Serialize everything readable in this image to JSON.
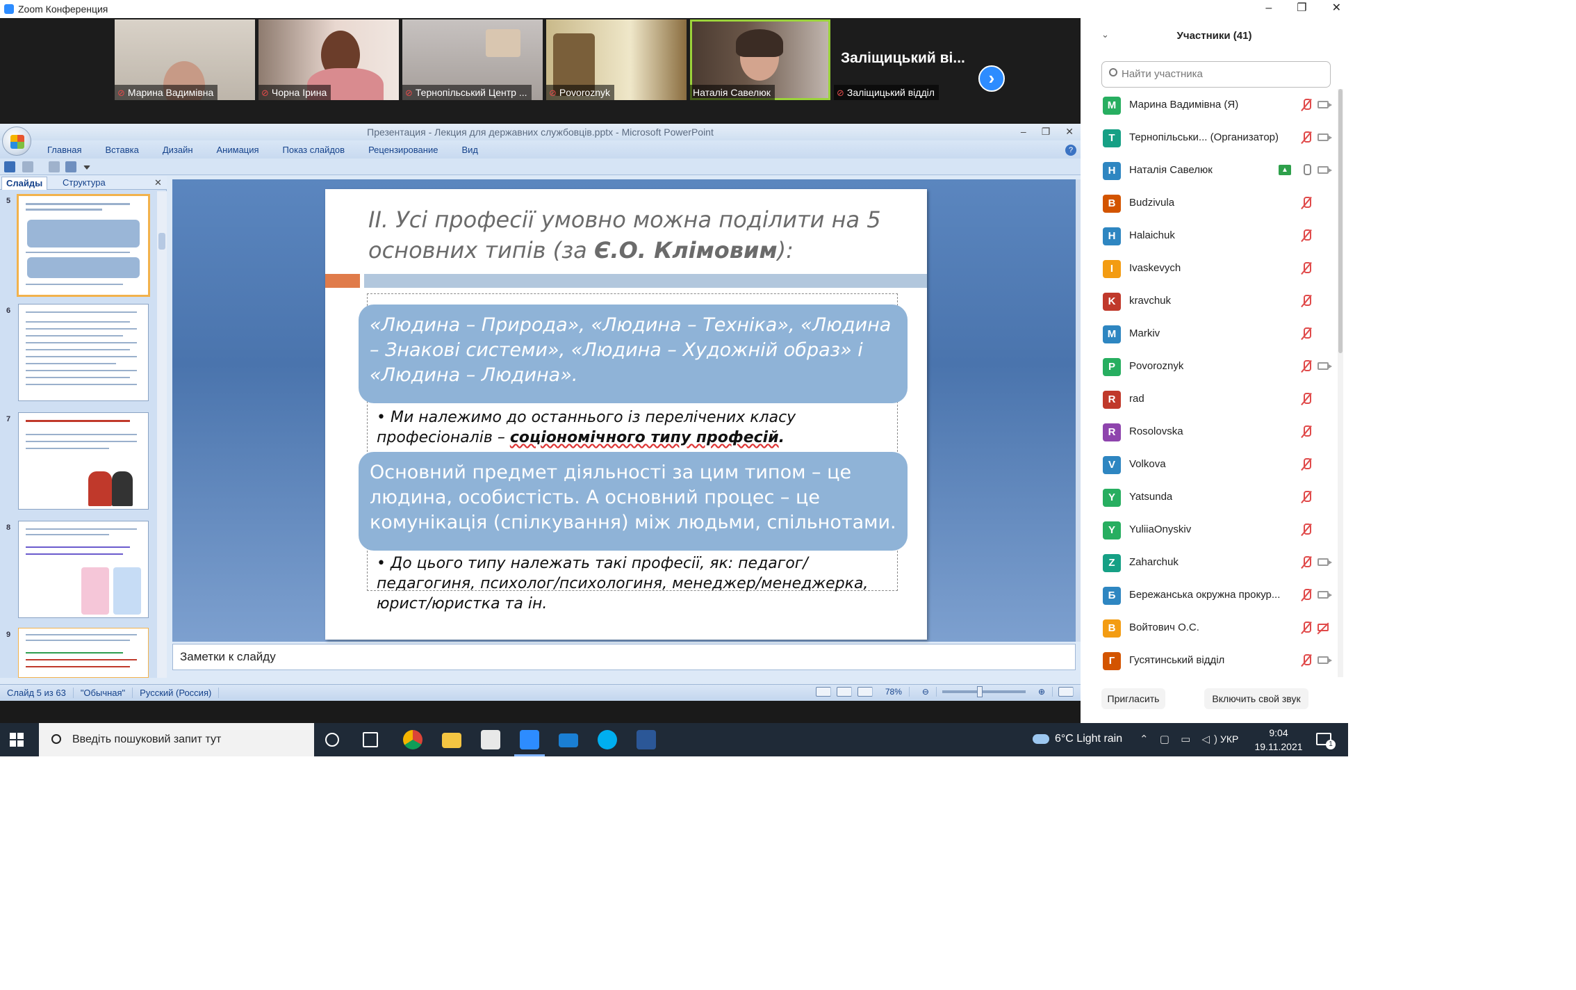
{
  "zoom": {
    "window_title": "Zoom Конференция",
    "tiles": [
      {
        "name": "Марина Вадимівна"
      },
      {
        "name": "Чорна Ірина"
      },
      {
        "name": "Тернопільський Центр ..."
      },
      {
        "name": "Povoroznyk"
      },
      {
        "name": "Наталія Савелюк"
      },
      {
        "name": "Заліщицький відділ",
        "big_label": "Заліщицький ві..."
      }
    ]
  },
  "ppt": {
    "title": "Презентация - Лекция для державних службовців.pptx - Microsoft PowerPoint",
    "ribbon": [
      "Главная",
      "Вставка",
      "Дизайн",
      "Анимация",
      "Показ слайдов",
      "Рецензирование",
      "Вид"
    ],
    "pane_tabs": {
      "slides": "Слайды",
      "outline": "Структура"
    },
    "thumb_numbers": [
      "5",
      "6",
      "7",
      "8",
      "9"
    ],
    "slide": {
      "title_part1": "ІІ. Усі професії умовно можна поділити на 5 основних типів (за ",
      "title_bold": "Є.О. Клімовим",
      "title_part2": "):",
      "bubble1": "«Людина – Природа», «Людина – Техніка», «Людина – Знакові системи», «Людина – Художній образ» і «Людина – Людина».",
      "bullet1_a": "Ми належимо до останнього із перелічених класу професіоналів – ",
      "bullet1_b": "соціономічного типу професій",
      "bullet1_c": ".",
      "bubble2": "Основний предмет діяльності за цим типом – це людина, особистість.  А основний процес – це комунікація (спілкування) між людьми, спільнотами.",
      "bullet2": "До цього типу належать такі професії, як: педагог/педагогиня, психолог/психологиня, менеджер/менеджерка, юрист/юристка та ін."
    },
    "notes_placeholder": "Заметки к слайду",
    "status": {
      "slide": "Слайд 5 из 63",
      "theme": "\"Обычная\"",
      "lang": "Русский (Россия)",
      "zoom": "78%"
    }
  },
  "participants": {
    "header": "Участники (41)",
    "search_placeholder": "Найти участника",
    "list": [
      {
        "initial": "М",
        "name": "Марина Вадимівна (Я)",
        "color": "#27ae60",
        "mic": "off",
        "video": "on"
      },
      {
        "initial": "Т",
        "name": "Тернопільськи... (Организатор)",
        "color": "#16a085",
        "mic": "off",
        "video": "on"
      },
      {
        "initial": "Н",
        "name": "Наталія Савелюк",
        "color": "#2e86c1",
        "mic": "on",
        "video": "on",
        "share": true
      },
      {
        "initial": "B",
        "name": "Budzivula",
        "color": "#d35400",
        "mic": "off",
        "video": "none"
      },
      {
        "initial": "H",
        "name": "Halaichuk",
        "color": "#2e86c1",
        "mic": "off",
        "video": "none"
      },
      {
        "initial": "I",
        "name": "Ivaskevych",
        "color": "#f39c12",
        "mic": "off",
        "video": "none"
      },
      {
        "initial": "K",
        "name": "kravchuk",
        "color": "#c0392b",
        "mic": "off",
        "video": "none"
      },
      {
        "initial": "M",
        "name": "Markiv",
        "color": "#2e86c1",
        "mic": "off",
        "video": "none"
      },
      {
        "initial": "P",
        "name": "Povoroznyk",
        "color": "#27ae60",
        "mic": "off",
        "video": "on"
      },
      {
        "initial": "R",
        "name": "rad",
        "color": "#c0392b",
        "mic": "off",
        "video": "none"
      },
      {
        "initial": "R",
        "name": "Rosolovska",
        "color": "#8e44ad",
        "mic": "off",
        "video": "none"
      },
      {
        "initial": "V",
        "name": "Volkova",
        "color": "#2e86c1",
        "mic": "off",
        "video": "none"
      },
      {
        "initial": "Y",
        "name": "Yatsunda",
        "color": "#27ae60",
        "mic": "off",
        "video": "none"
      },
      {
        "initial": "Y",
        "name": "YuliiaOnyskiv",
        "color": "#27ae60",
        "mic": "off",
        "video": "none"
      },
      {
        "initial": "Z",
        "name": "Zaharchuk",
        "color": "#16a085",
        "mic": "off",
        "video": "on"
      },
      {
        "initial": "Б",
        "name": "Бережанська окружна прокур...",
        "color": "#2e86c1",
        "mic": "off",
        "video": "on"
      },
      {
        "initial": "В",
        "name": "Войтович О.С.",
        "color": "#f39c12",
        "mic": "off",
        "video": "off"
      },
      {
        "initial": "Г",
        "name": "Гусятинський відділ",
        "color": "#d35400",
        "mic": "off",
        "video": "on"
      }
    ],
    "invite": "Пригласить",
    "unmute": "Включить свой звук"
  },
  "taskbar": {
    "search_placeholder": "Введіть пошуковий запит тут",
    "weather": "6°C  Light rain",
    "lang": "УКР",
    "time": "9:04",
    "date": "19.11.2021",
    "notify_count": "1"
  }
}
